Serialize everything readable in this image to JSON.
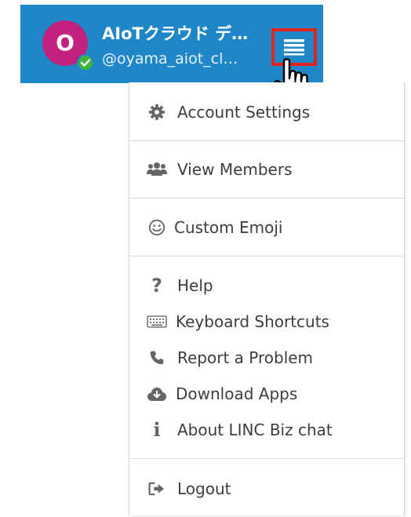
{
  "header": {
    "avatar_initial": "O",
    "team_name": "AIoTクラウド デ…",
    "username": "@oyama_aiot_cl…",
    "background_color": "#1f87c7",
    "avatar_color": "#c2227f",
    "status": "online",
    "status_color": "#3fb53b",
    "menu_highlight_color": "#e2231a"
  },
  "menu": {
    "items": [
      {
        "label": "Account Settings",
        "icon": "gear-icon"
      },
      {
        "label": "View Members",
        "icon": "users-icon"
      },
      {
        "label": "Custom Emoji",
        "icon": "smiley-icon"
      },
      {
        "label": "Help",
        "icon": "question-icon"
      },
      {
        "label": "Keyboard Shortcuts",
        "icon": "keyboard-icon"
      },
      {
        "label": "Report a Problem",
        "icon": "phone-icon"
      },
      {
        "label": "Download Apps",
        "icon": "cloud-download-icon"
      },
      {
        "label": "About LINC Biz chat",
        "icon": "info-icon"
      },
      {
        "label": "Logout",
        "icon": "logout-icon"
      }
    ]
  }
}
